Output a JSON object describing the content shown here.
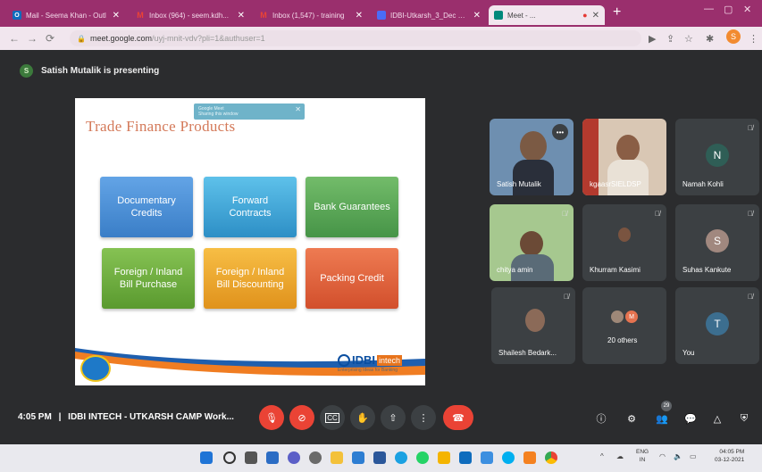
{
  "browser": {
    "tabs": [
      {
        "title": "Mail - Seema Khan - Outl",
        "favicon": "outlook-icon",
        "color": "#0f6cbd"
      },
      {
        "title": "Inbox (964) - seem.kdh...",
        "favicon": "gmail-icon",
        "color": "#ea4335"
      },
      {
        "title": "Inbox (1,547) - training",
        "favicon": "gmail-icon",
        "color": "#ea4335"
      },
      {
        "title": "IDBI-Utkarsh_3_Dec 202",
        "favicon": "slides-icon",
        "color": "#4a6cf7"
      },
      {
        "title": "Meet - ...",
        "favicon": "meet-icon",
        "color": "#00897b"
      }
    ],
    "url": "meet.google.com",
    "url_path": "/uyj-mnit-vdv?pli=1&authuser=1",
    "profile_initial": "S"
  },
  "meet": {
    "presenter_banner": "Satish Mutalik is presenting",
    "presenter_initial": "S",
    "time": "4:05 PM",
    "meeting_name": "IDBI INTECH - UTKARSH CAMP Work...",
    "people_count": "29",
    "participants": [
      {
        "name": "Satish Mutalik",
        "type": "video"
      },
      {
        "name": "kgaasrSIELDSP",
        "type": "video"
      },
      {
        "name": "Namah Kohli",
        "type": "initial",
        "initial": "N",
        "color": "#2f5e56"
      },
      {
        "name": "chitya amin",
        "type": "video"
      },
      {
        "name": "Khurram Kasimi",
        "type": "video"
      },
      {
        "name": "Suhas Kankute",
        "type": "initial",
        "initial": "S",
        "color": "#a1887f"
      },
      {
        "name": "Shailesh Bedark...",
        "type": "video"
      },
      {
        "name": "20 others",
        "type": "others",
        "initial": "M"
      },
      {
        "name": "You",
        "type": "initial",
        "initial": "T",
        "color": "#3c6e8f"
      }
    ]
  },
  "slide": {
    "title": "Trade Finance Products",
    "sharing_pill": {
      "line1": "Google Meet",
      "line2": "Sharing this window"
    },
    "products": [
      {
        "line1": "Documentary",
        "line2": "Credits",
        "color": "#4a90d6"
      },
      {
        "line1": "Forward",
        "line2": "Contracts",
        "color": "#42a5d8"
      },
      {
        "line1": "Bank Guarantees",
        "line2": "",
        "color": "#5aa55a"
      },
      {
        "line1": "Foreign / Inland",
        "line2": "Bill Purchase",
        "color": "#6aaf3e"
      },
      {
        "line1": "Foreign / Inland",
        "line2": "Bill Discounting",
        "color": "#f0a92e"
      },
      {
        "line1": "Packing Credit",
        "line2": "",
        "color": "#e4663f"
      }
    ],
    "logo_brand": "IDBI",
    "logo_sub": "intech",
    "logo_tagline": "Enterprising Ideas for Banking"
  },
  "taskbar": {
    "lang": "ENG",
    "region": "IN",
    "time": "04:05 PM",
    "date": "03-12-2021"
  }
}
